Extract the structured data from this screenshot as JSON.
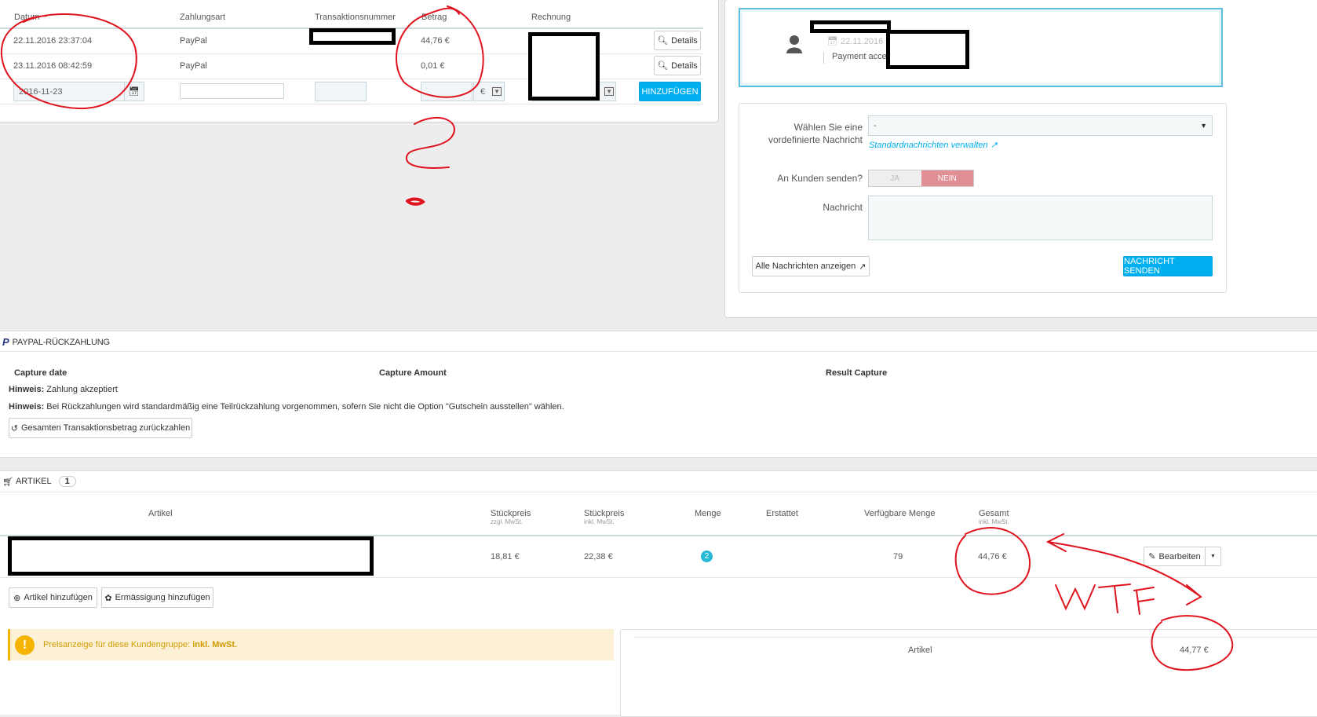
{
  "payments": {
    "headers": [
      "Datum",
      "Zahlungsart",
      "Transaktionsnummer",
      "Betrag",
      "Rechnung"
    ],
    "rows": [
      {
        "date": "22.11.2016 23:37:04",
        "method": "PayPal",
        "amount": "44,76 €",
        "action": "Details"
      },
      {
        "date": "23.11.2016 08:42:59",
        "method": "PayPal",
        "amount": "0,01 €",
        "action": "Details"
      }
    ],
    "new_row": {
      "date_value": "2016-11-23",
      "currency": "€",
      "add_label": "HINZUFÜGEN"
    }
  },
  "message_panel": {
    "status_date": "22.11.2016 -",
    "status_text": "Payment accep",
    "predefined_label_1": "Wählen Sie eine",
    "predefined_label_2": "vordefinierte Nachricht",
    "predefined_value": "-",
    "manage_link": "Standardnachrichten verwalten",
    "send_customer_label": "An Kunden senden?",
    "toggle_yes": "JA",
    "toggle_no": "NEIN",
    "message_label": "Nachricht",
    "show_all_label": "Alle Nachrichten anzeigen",
    "send_label": "NACHRICHT SENDEN"
  },
  "paypal_refund": {
    "title": "PAYPAL-RÜCKZAHLUNG",
    "col_capture_date": "Capture date",
    "col_capture_amount": "Capture Amount",
    "col_result": "Result Capture",
    "hint_label": "Hinweis:",
    "hint1": "Zahlung akzeptiert",
    "hint2": "Bei Rückzahlungen wird standardmäßig eine Teilrückzahlung vorgenommen, sofern Sie nicht die Option \"Gutschein ausstellen\" wählen.",
    "refund_button": "Gesamten Transaktionsbetrag zurückzahlen"
  },
  "articles": {
    "title": "ARTIKEL",
    "count": "1",
    "headers": {
      "artikel": "Artikel",
      "unit_price_ex": "Stückpreis",
      "unit_price_ex_sub": "zzgl. MwSt.",
      "unit_price_inc": "Stückpreis",
      "unit_price_inc_sub": "inkl. MwSt.",
      "qty": "Menge",
      "refunded": "Erstattet",
      "available": "Verfügbare Menge",
      "total": "Gesamt",
      "total_sub": "inkl. MwSt."
    },
    "row": {
      "unit_ex": "18,81 €",
      "unit_inc": "22,38 €",
      "qty": "2",
      "available": "79",
      "total": "44,76 €",
      "edit": "Bearbeiten"
    },
    "add_article": "Artikel hinzufügen",
    "add_discount": "Ermässigung hinzufügen",
    "price_notice": "Preisanzeige für diese Kundengruppe:",
    "price_notice_bold": "inkl. MwSt.",
    "summary_label": "Artikel",
    "summary_value": "44,77 €"
  },
  "annotations": {
    "question": "?",
    "wtf": "WTF"
  },
  "colors": {
    "accent": "#00aff0",
    "annotation": "#e0141e",
    "no_toggle": "#e08f95"
  }
}
